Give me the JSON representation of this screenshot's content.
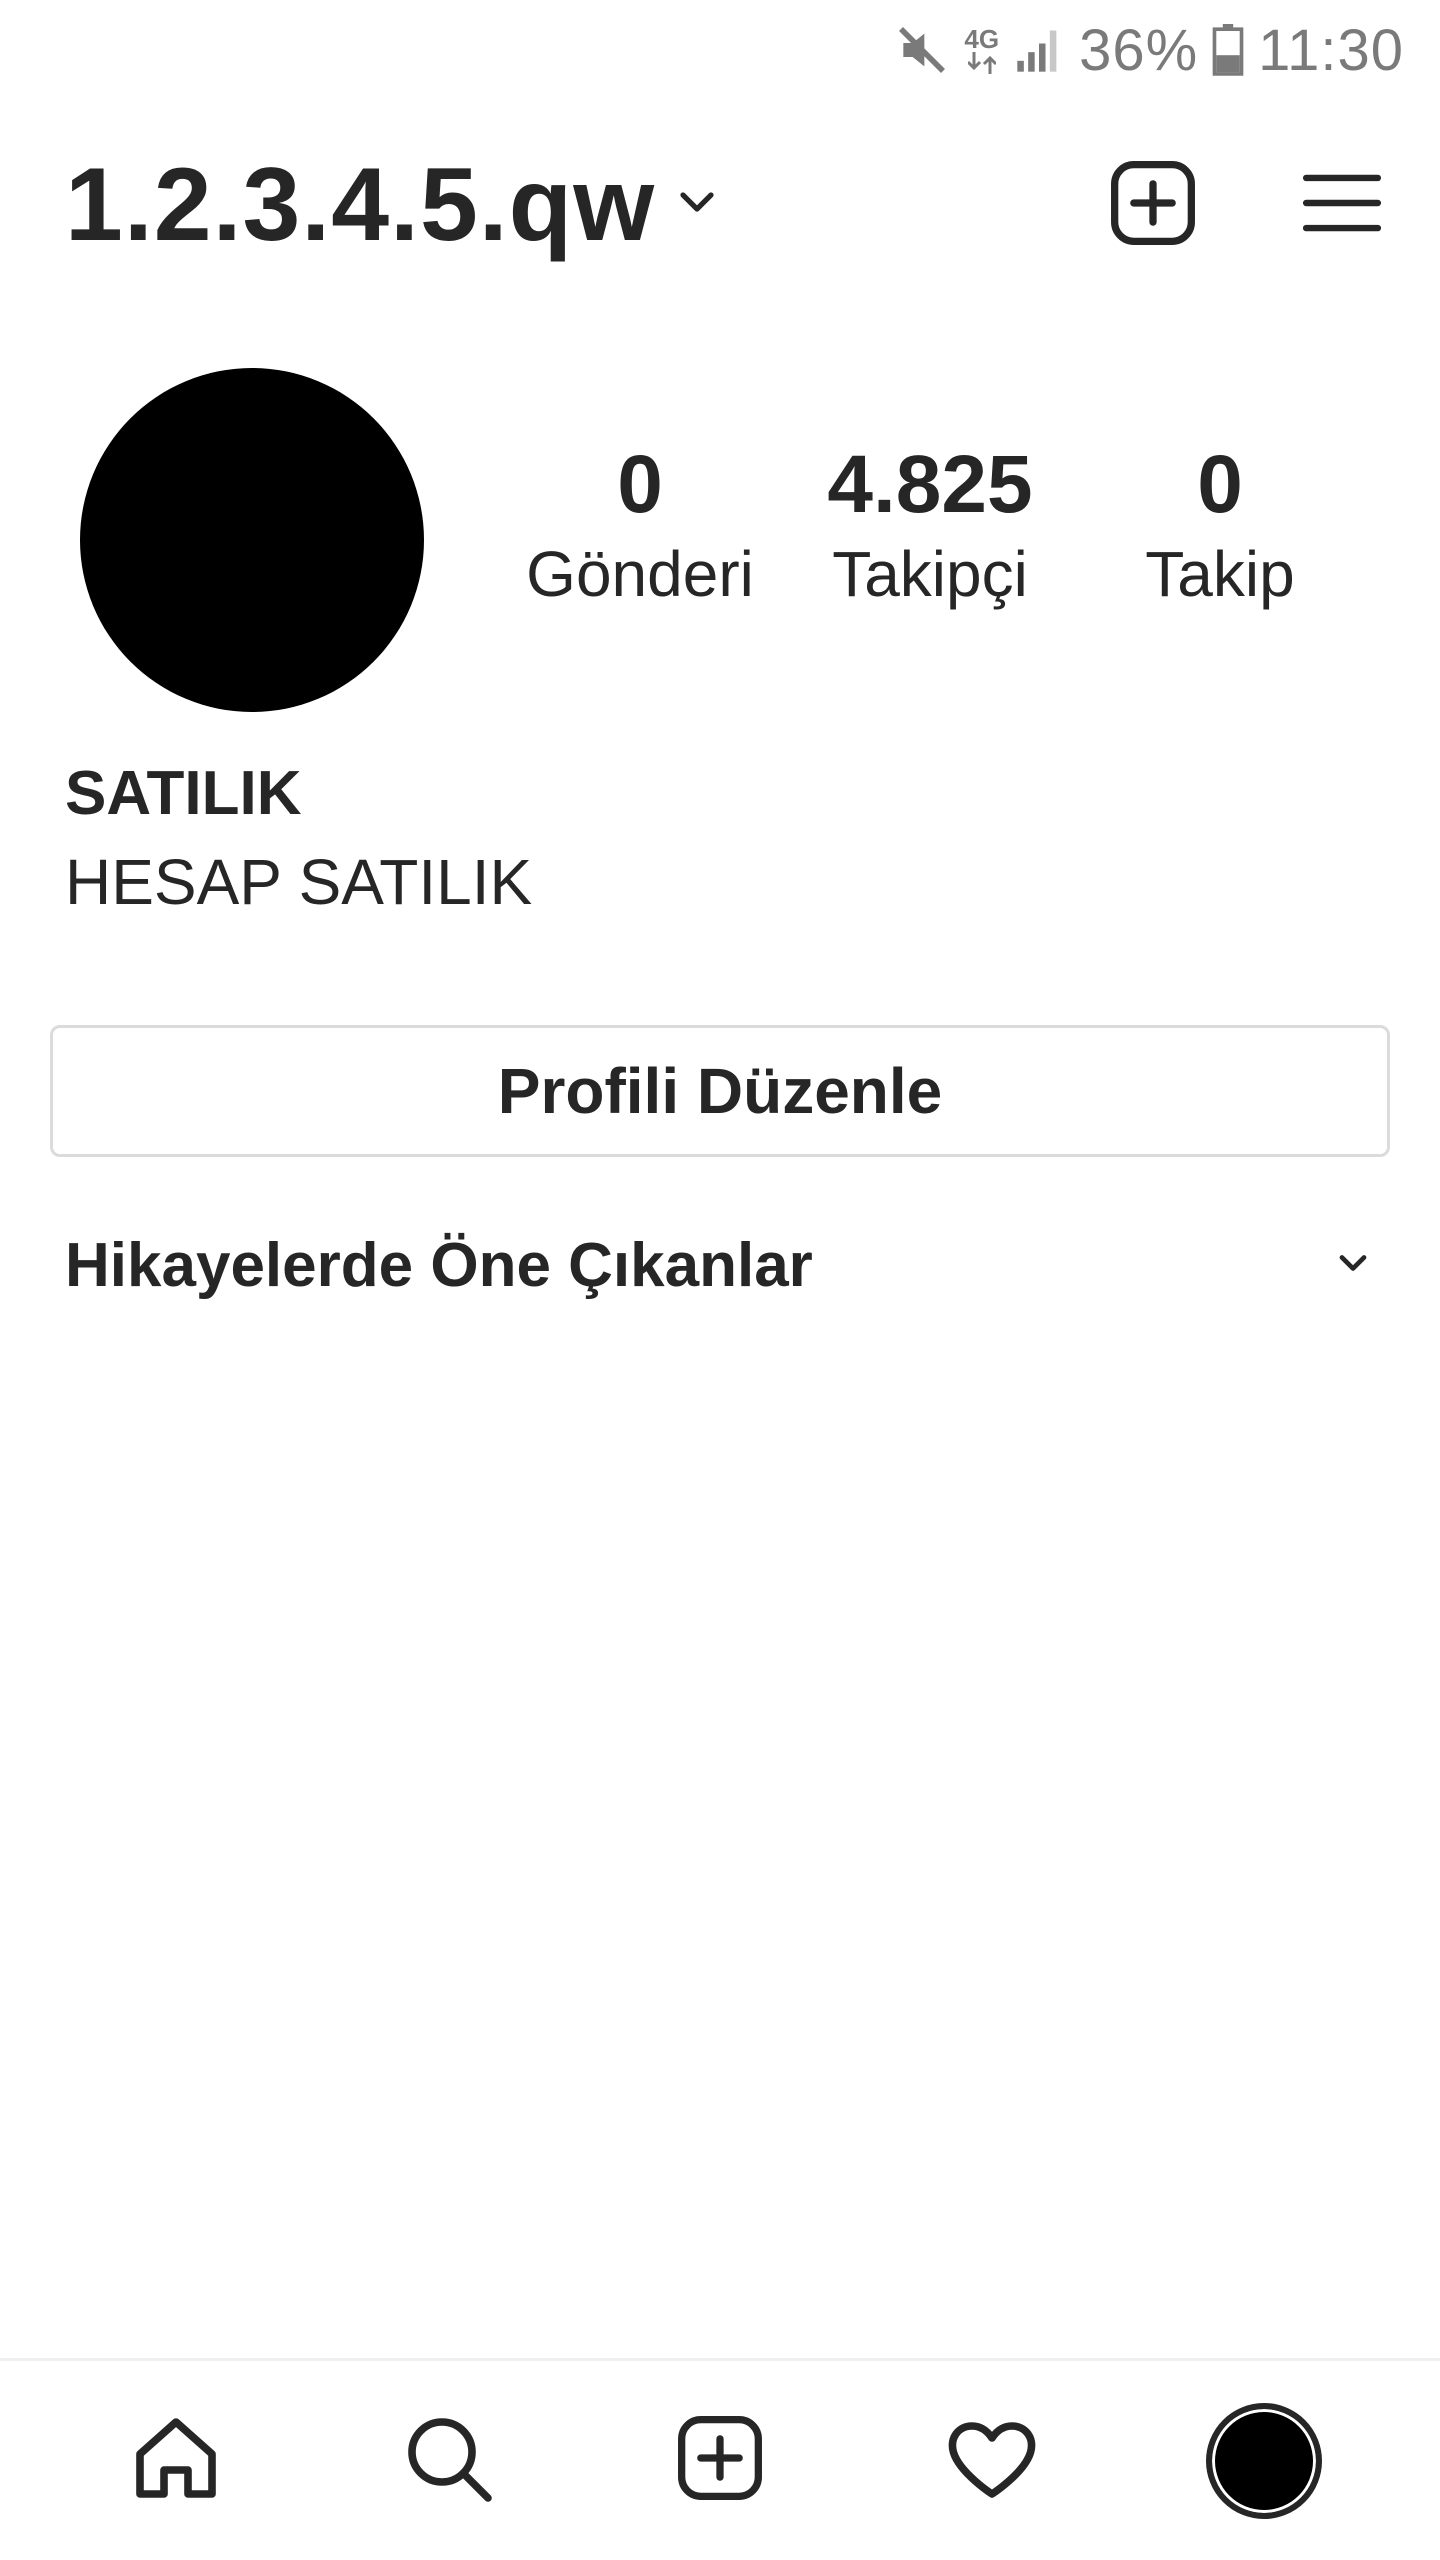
{
  "status_bar": {
    "network": "4G",
    "battery_percent": "36%",
    "time": "11:30",
    "icons": [
      "mute-icon",
      "network-4g-icon",
      "signal-icon",
      "battery-icon"
    ]
  },
  "header": {
    "username": "1.2.3.4.5.qw",
    "icons": [
      "chevron-down-icon",
      "new-post-icon",
      "menu-icon"
    ]
  },
  "profile": {
    "stats": [
      {
        "value": "0",
        "label": "Gönderi"
      },
      {
        "value": "4.825",
        "label": "Takipçi"
      },
      {
        "value": "0",
        "label": "Takip"
      }
    ],
    "name": "SATILIK",
    "bio": "HESAP SATILIK"
  },
  "actions": {
    "edit_profile_label": "Profili Düzenle"
  },
  "highlights": {
    "title": "Hikayelerde Öne Çıkanlar"
  },
  "bottom_nav": {
    "items": [
      "home-icon",
      "search-icon",
      "add-post-icon",
      "activity-heart-icon",
      "profile-avatar"
    ]
  },
  "colors": {
    "text": "#262626",
    "status_gray": "#7a7a7a",
    "border": "#dbdbdb",
    "background": "#ffffff"
  }
}
